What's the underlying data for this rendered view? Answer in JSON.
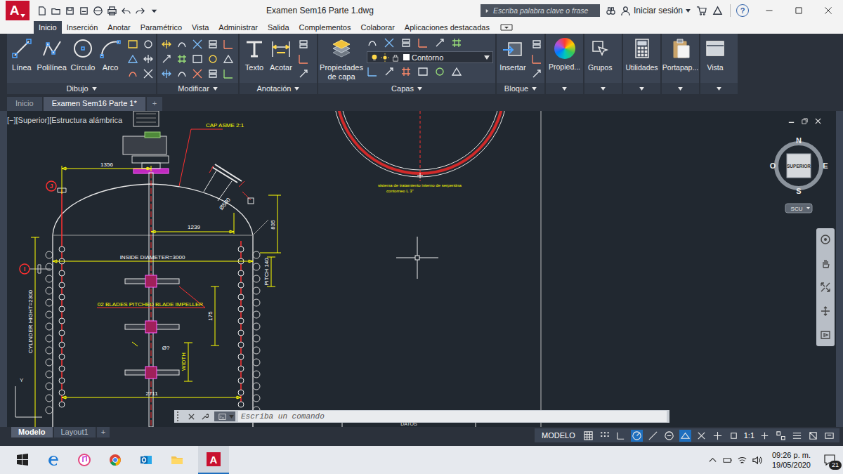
{
  "app": {
    "logo": "A",
    "title": "Examen Sem16 Parte 1.dwg",
    "search_placeholder": "Escriba palabra clave o frase",
    "sign_in": "Iniciar sesión",
    "help": "?"
  },
  "ribbon_tabs": [
    {
      "label": "Inicio",
      "selected": true
    },
    {
      "label": "Inserción",
      "selected": false
    },
    {
      "label": "Anotar",
      "selected": false
    },
    {
      "label": "Paramétrico",
      "selected": false
    },
    {
      "label": "Vista",
      "selected": false
    },
    {
      "label": "Administrar",
      "selected": false
    },
    {
      "label": "Salida",
      "selected": false
    },
    {
      "label": "Complementos",
      "selected": false
    },
    {
      "label": "Colaborar",
      "selected": false
    },
    {
      "label": "Aplicaciones destacadas",
      "selected": false
    }
  ],
  "ribbon_panels": [
    {
      "title": "Dibujo",
      "kind": "draw",
      "tools": [
        "Línea",
        "Polilínea",
        "Círculo",
        "Arco"
      ],
      "layer": ""
    },
    {
      "title": "Modificar",
      "kind": "modify",
      "tools": [],
      "layer": ""
    },
    {
      "title": "Anotación",
      "kind": "annotate",
      "tools": [
        "Texto",
        "Acotar"
      ],
      "layer": ""
    },
    {
      "title": "Capas",
      "kind": "layers",
      "tools": [
        "Propiedades de capa"
      ],
      "layer": "Contorno"
    },
    {
      "title": "Bloque",
      "kind": "block",
      "tools": [
        "Insertar"
      ],
      "layer": ""
    },
    {
      "title": "",
      "kind": "single",
      "tools": [
        "Propied..."
      ],
      "layer": ""
    },
    {
      "title": "",
      "kind": "single",
      "tools": [
        "Grupos"
      ],
      "layer": ""
    },
    {
      "title": "",
      "kind": "single",
      "tools": [
        "Utilidades"
      ],
      "layer": ""
    },
    {
      "title": "",
      "kind": "single",
      "tools": [
        "Portapap..."
      ],
      "layer": ""
    },
    {
      "title": "",
      "kind": "single",
      "tools": [
        "Vista"
      ],
      "layer": ""
    }
  ],
  "doc_tabs": [
    {
      "label": "Inicio",
      "selected": false
    },
    {
      "label": "Examen Sem16 Parte 1*",
      "selected": true
    }
  ],
  "new_tab": "+",
  "viewport": {
    "label": "[−][Superior][Estructura alámbrica"
  },
  "drawing": {
    "cap": "CAP ASME 2:1",
    "dim_top": "1356",
    "dim_mid": "1239",
    "dim_height": "835",
    "nozzle": "Ø500",
    "diameter": "INSIDE DIAMETER=3000",
    "pitch": "PITCH 140",
    "impeller": "02 BLADES PITCHED BLADE IMPELLER",
    "cylinder": "CYLINDER HIGHT=2300",
    "spacing": "175",
    "blade_dia": "Ø?",
    "width": "WIDTH",
    "bottom": "2711",
    "marker_j": "J",
    "marker_i": "I",
    "note": [
      "sistema de tratamiento interno de serpentina",
      "contorneo L 3\""
    ],
    "datos": "DATOS",
    "axis": "Y"
  },
  "viewcube": {
    "north": "N",
    "south": "S",
    "east": "E",
    "west": "O",
    "face": "SUPERIOR",
    "ucs": "SCU"
  },
  "command_line": {
    "placeholder": "Escriba un comando"
  },
  "layout_tabs": [
    {
      "label": "Modelo",
      "selected": true
    },
    {
      "label": "Layout1",
      "selected": false
    }
  ],
  "layout_new": "+",
  "status_bar": {
    "space": "MODELO",
    "scale": "1:1"
  },
  "taskbar": {
    "autocad_logo": "A",
    "time": "09:26 p. m.",
    "date": "19/05/2020",
    "notifications": "21"
  }
}
